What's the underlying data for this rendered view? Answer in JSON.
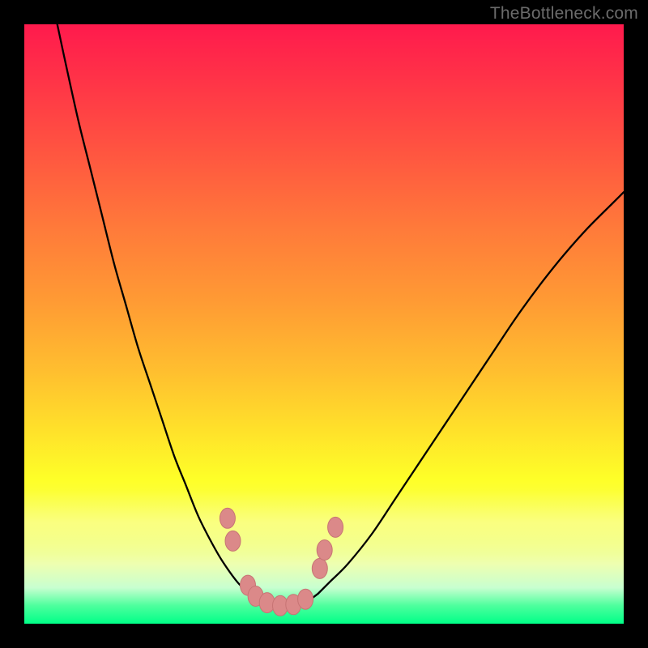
{
  "watermark_text": "TheBottleneck.com",
  "colors": {
    "frame": "#000000",
    "curve_stroke": "#000000",
    "marker_fill": "#db8989",
    "marker_stroke": "#c77474",
    "highlight_marker_fill": "#eaa4a4"
  },
  "chart_data": {
    "type": "line",
    "title": "",
    "xlabel": "",
    "ylabel": "",
    "xlim": [
      0,
      100
    ],
    "ylim": [
      0,
      100
    ],
    "note": "No axes/ticks shown in image; x is normalized 0–100 left→right, y is normalized 0–100 with 0 at bottom (green) and 100 at top (red). Values estimated from pixels.",
    "series": [
      {
        "name": "left-branch",
        "x": [
          5.5,
          7,
          9,
          11,
          13,
          15,
          17,
          19,
          21,
          23,
          25,
          27,
          29,
          31,
          33,
          35.5,
          37.5
        ],
        "y": [
          100,
          93,
          84,
          76,
          68,
          60,
          53,
          46,
          40,
          34,
          28,
          23,
          18,
          14,
          10.5,
          7,
          5
        ]
      },
      {
        "name": "right-branch",
        "x": [
          49,
          51,
          54,
          58,
          62,
          66,
          70,
          74,
          78,
          82,
          86,
          90,
          94,
          98,
          100
        ],
        "y": [
          5,
          7,
          10,
          15,
          21,
          27,
          33,
          39,
          45,
          51,
          56.5,
          61.5,
          66,
          70,
          72
        ]
      },
      {
        "name": "valley-floor",
        "x": [
          37.5,
          40,
          43,
          46,
          49
        ],
        "y": [
          5,
          3.2,
          2.8,
          3.0,
          5
        ]
      }
    ],
    "markers": [
      {
        "series": "left-branch-markers",
        "x": 33.9,
        "y": 17.6,
        "style": "pink-dot"
      },
      {
        "series": "left-branch-markers",
        "x": 34.8,
        "y": 13.8,
        "style": "pink-dot"
      },
      {
        "series": "valley-markers",
        "x": 37.3,
        "y": 6.4,
        "style": "pink-dot"
      },
      {
        "series": "valley-markers",
        "x": 38.6,
        "y": 4.6,
        "style": "pink-dot"
      },
      {
        "series": "valley-markers",
        "x": 40.5,
        "y": 3.5,
        "style": "pink-dot"
      },
      {
        "series": "valley-markers",
        "x": 42.7,
        "y": 3.0,
        "style": "pink-dot"
      },
      {
        "series": "valley-markers",
        "x": 44.9,
        "y": 3.2,
        "style": "pink-dot"
      },
      {
        "series": "valley-markers",
        "x": 46.9,
        "y": 4.1,
        "style": "pink-dot"
      },
      {
        "series": "right-branch-markers",
        "x": 49.3,
        "y": 9.2,
        "style": "pink-dot"
      },
      {
        "series": "right-branch-markers",
        "x": 50.1,
        "y": 12.3,
        "style": "pink-dot"
      },
      {
        "series": "right-branch-markers",
        "x": 51.9,
        "y": 16.1,
        "style": "pink-dot"
      }
    ]
  }
}
